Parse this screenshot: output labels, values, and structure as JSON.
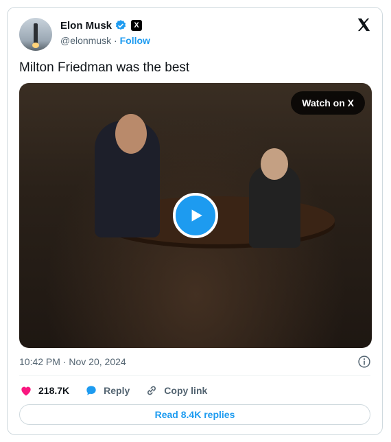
{
  "author": {
    "name": "Elon Musk",
    "handle": "@elonmusk",
    "separator": "·",
    "follow_label": "Follow",
    "badge_label": "X"
  },
  "tweet": {
    "text": "Milton Friedman was the best"
  },
  "media": {
    "watch_label": "Watch on X"
  },
  "meta": {
    "time": "10:42 PM",
    "separator": "·",
    "date": "Nov 20, 2024"
  },
  "actions": {
    "likes": "218.7K",
    "reply_label": "Reply",
    "copy_label": "Copy link"
  },
  "footer": {
    "read_replies_label": "Read 8.4K replies"
  },
  "colors": {
    "accent": "#1d9bf0",
    "like": "#f91880",
    "text": "#0f1419",
    "muted": "#536471"
  },
  "icons": [
    "verified-icon",
    "x-logo-icon",
    "play-icon",
    "info-icon",
    "heart-icon",
    "reply-icon",
    "link-icon"
  ]
}
